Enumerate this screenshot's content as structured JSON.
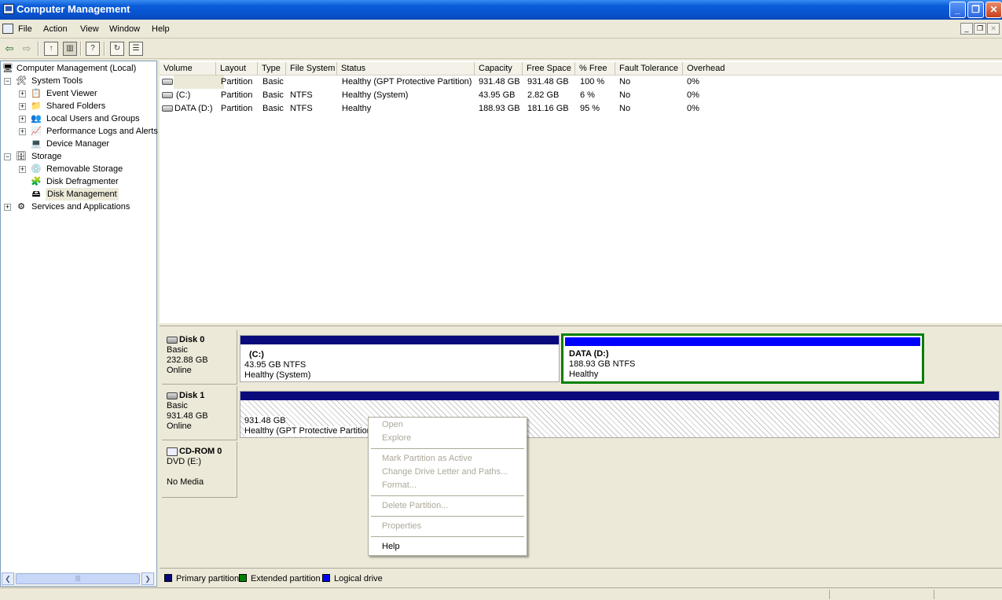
{
  "window": {
    "title": "Computer Management",
    "minimize": "_",
    "restore": "❐",
    "close": "✕"
  },
  "menu": {
    "items": [
      "File",
      "Action",
      "View",
      "Window",
      "Help"
    ]
  },
  "tree": {
    "items": [
      {
        "label": "Computer Management (Local)",
        "icon": "computer-icon"
      },
      {
        "label": "System Tools",
        "icon": "tools-icon"
      },
      {
        "label": "Event Viewer",
        "icon": "event-viewer-icon"
      },
      {
        "label": "Shared Folders",
        "icon": "shared-folders-icon"
      },
      {
        "label": "Local Users and Groups",
        "icon": "users-icon"
      },
      {
        "label": "Performance Logs and Alerts",
        "icon": "performance-icon"
      },
      {
        "label": "Device Manager",
        "icon": "device-manager-icon"
      },
      {
        "label": "Storage",
        "icon": "storage-icon"
      },
      {
        "label": "Removable Storage",
        "icon": "removable-storage-icon"
      },
      {
        "label": "Disk Defragmenter",
        "icon": "defragmenter-icon"
      },
      {
        "label": "Disk Management",
        "icon": "disk-management-icon",
        "selected": true
      },
      {
        "label": "Services and Applications",
        "icon": "services-icon"
      }
    ]
  },
  "volumes": {
    "columns": [
      "Volume",
      "Layout",
      "Type",
      "File System",
      "Status",
      "Capacity",
      "Free Space",
      "% Free",
      "Fault Tolerance",
      "Overhead"
    ],
    "rows": [
      [
        "",
        "Partition",
        "Basic",
        "",
        "Healthy (GPT Protective Partition)",
        "931.48 GB",
        "931.48 GB",
        "100 %",
        "No",
        "0%"
      ],
      [
        "(C:)",
        "Partition",
        "Basic",
        "NTFS",
        "Healthy (System)",
        "43.95 GB",
        "2.82 GB",
        "6 %",
        "No",
        "0%"
      ],
      [
        "DATA (D:)",
        "Partition",
        "Basic",
        "NTFS",
        "Healthy",
        "188.93 GB",
        "181.16 GB",
        "95 %",
        "No",
        "0%"
      ]
    ]
  },
  "disks": [
    {
      "name": "Disk 0",
      "type": "Basic",
      "size": "232.88 GB",
      "status": "Online",
      "partitions": [
        {
          "title": "(C:)",
          "size": "43.95 GB NTFS",
          "status": "Healthy (System)",
          "color": "#0a0a7c"
        },
        {
          "title": "DATA  (D:)",
          "size": "188.93 GB NTFS",
          "status": "Healthy",
          "color": "#0000ff",
          "border": "#008000"
        }
      ]
    },
    {
      "name": "Disk 1",
      "type": "Basic",
      "size": "931.48 GB",
      "status": "Online",
      "partitions": [
        {
          "title": "",
          "size": "931.48 GB",
          "status": "Healthy (GPT Protective Partition)",
          "color": "#0a0a7c"
        }
      ]
    },
    {
      "name": "CD-ROM 0",
      "type": "DVD (E:)",
      "size": "",
      "status": "No Media"
    }
  ],
  "legend": [
    {
      "label": "Primary partition",
      "color": "#0a0a7c"
    },
    {
      "label": "Extended partition",
      "color": "#008000"
    },
    {
      "label": "Logical drive",
      "color": "#0000ff"
    }
  ],
  "context_menu": {
    "open": "Open",
    "explore": "Explore",
    "mark_active": "Mark Partition as Active",
    "change_letter": "Change Drive Letter and Paths...",
    "format": "Format...",
    "delete": "Delete Partition...",
    "properties": "Properties",
    "help": "Help"
  }
}
